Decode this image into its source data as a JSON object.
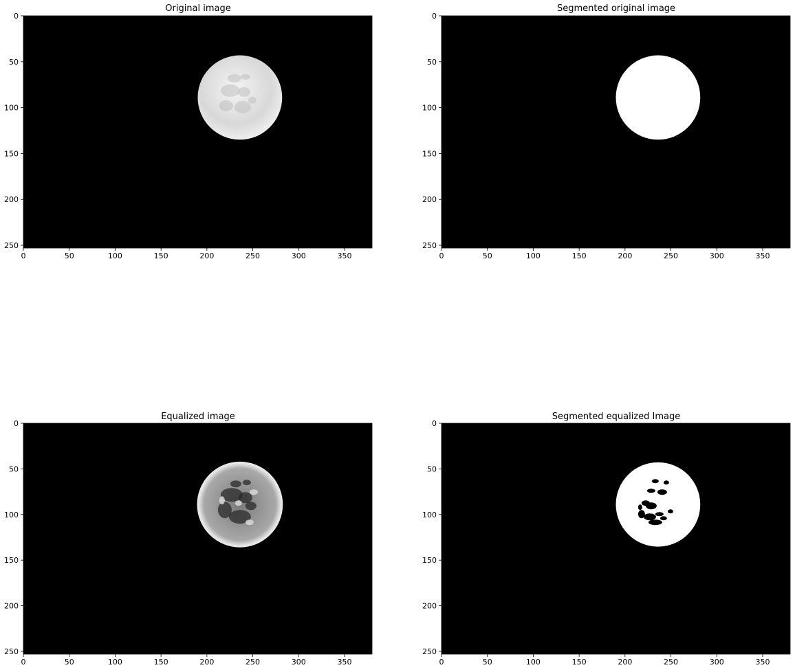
{
  "panels": [
    {
      "title": "Original image",
      "kind": "original"
    },
    {
      "title": "Segmented original image",
      "kind": "segmented"
    },
    {
      "title": "Equalized image",
      "kind": "equalized"
    },
    {
      "title": "Segmented equalized Image",
      "kind": "segmented_equalized"
    }
  ],
  "axes": {
    "x_ticks": [
      0,
      50,
      100,
      150,
      200,
      250,
      300,
      350
    ],
    "y_ticks": [
      0,
      50,
      100,
      150,
      200,
      250
    ],
    "x_range": [
      0,
      380
    ],
    "y_range": [
      0,
      253
    ]
  },
  "moon": {
    "center_x": 236,
    "center_y": 89,
    "radius": 46
  },
  "colors": {
    "background": "#000000",
    "moon_bright": "#e6e6e6",
    "moon_mid": "#bdbdbd",
    "segment_white": "#ffffff"
  }
}
